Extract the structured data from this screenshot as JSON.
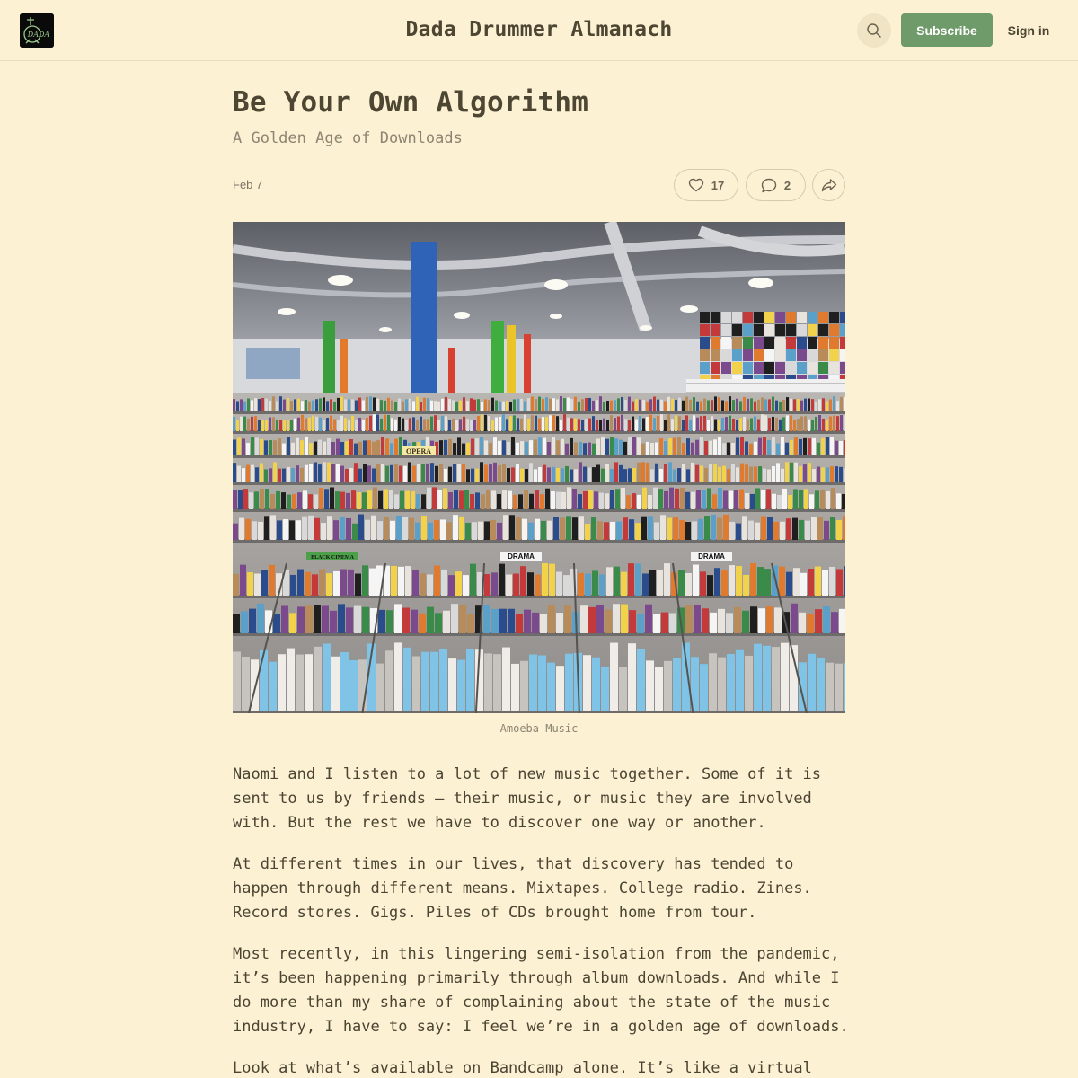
{
  "header": {
    "logo_text": "DADA",
    "site_title": "Dada Drummer Almanach",
    "search_icon": "search-icon",
    "subscribe_label": "Subscribe",
    "signin_label": "Sign in"
  },
  "post": {
    "title": "Be Your Own Algorithm",
    "subtitle": "A Golden Age of Downloads",
    "date": "Feb 7",
    "likes": "17",
    "comments": "2",
    "image_caption": "Amoeba Music",
    "image_signs": [
      "OPERA",
      "BLACK CINEMA",
      "DRAMA",
      "DRAMA"
    ],
    "paragraphs": [
      "Naomi and I listen to a lot of new music together. Some of it is sent to us by friends — their music, or music they are involved with. But the rest we have to discover one way or another.",
      "At different times in our lives, that discovery has tended to happen through different means. Mixtapes. College radio. Zines. Record stores. Gigs. Piles of CDs brought home from tour.",
      "Most recently, in this lingering semi-isolation from the pandemic, it’s been happening primarily through album downloads. And while I do more than my share of complaining about the state of the music industry, I have to say: I feel we’re in a golden age of downloads."
    ],
    "last_paragraph": {
      "before": "Look at what’s available on ",
      "link": "Bandcamp",
      "after": " alone. It’s like a virtual"
    }
  },
  "colors": {
    "background": "#fdf1d4",
    "accent": "#6f9a6a",
    "text": "#4a4433",
    "muted": "#8c8573"
  }
}
